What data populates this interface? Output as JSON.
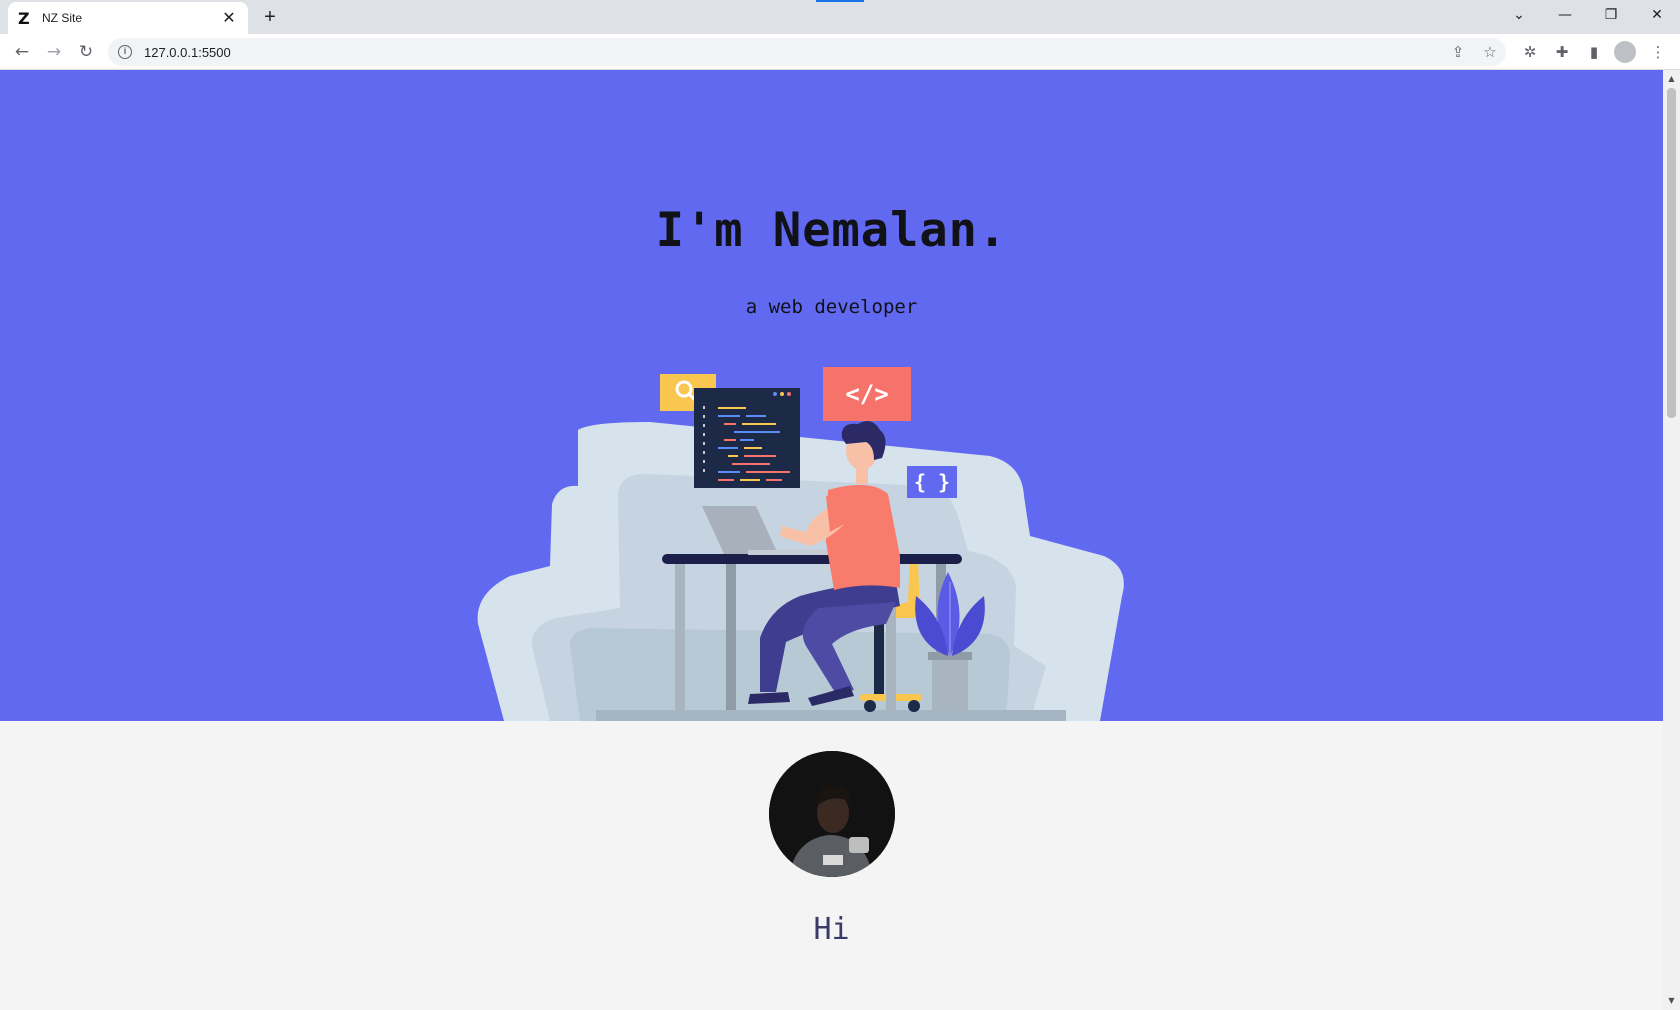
{
  "browser": {
    "tab": {
      "favicon": "Z",
      "title": "NZ Site",
      "close": "✕"
    },
    "new_tab": "+",
    "window_controls": {
      "tab_search": "⌄",
      "minimize": "—",
      "restore": "❐",
      "close": "✕"
    },
    "nav": {
      "back": "←",
      "forward": "→",
      "reload": "↻"
    },
    "address": {
      "info": "i",
      "url": "127.0.0.1:5500"
    },
    "icons": [
      "share-icon",
      "bookmark-star-icon",
      "extension-bug-icon",
      "extensions-puzzle-icon",
      "side-panel-icon",
      "profile-icon",
      "menu-icon"
    ]
  },
  "hero": {
    "title": "I'm Nemalan.",
    "subtitle": "a web developer",
    "illustration": {
      "code_tag": "</>",
      "braces": "{ }",
      "colors": {
        "background": "#6069f0",
        "search_box": "#f9c74f",
        "code_box": "#f5736b",
        "sofa": "#d6e2ec",
        "shirt": "#f87b6b",
        "pants": "#3f3d8f",
        "plant": "#5b5ce6"
      }
    }
  },
  "about": {
    "greeting": "Hi"
  }
}
